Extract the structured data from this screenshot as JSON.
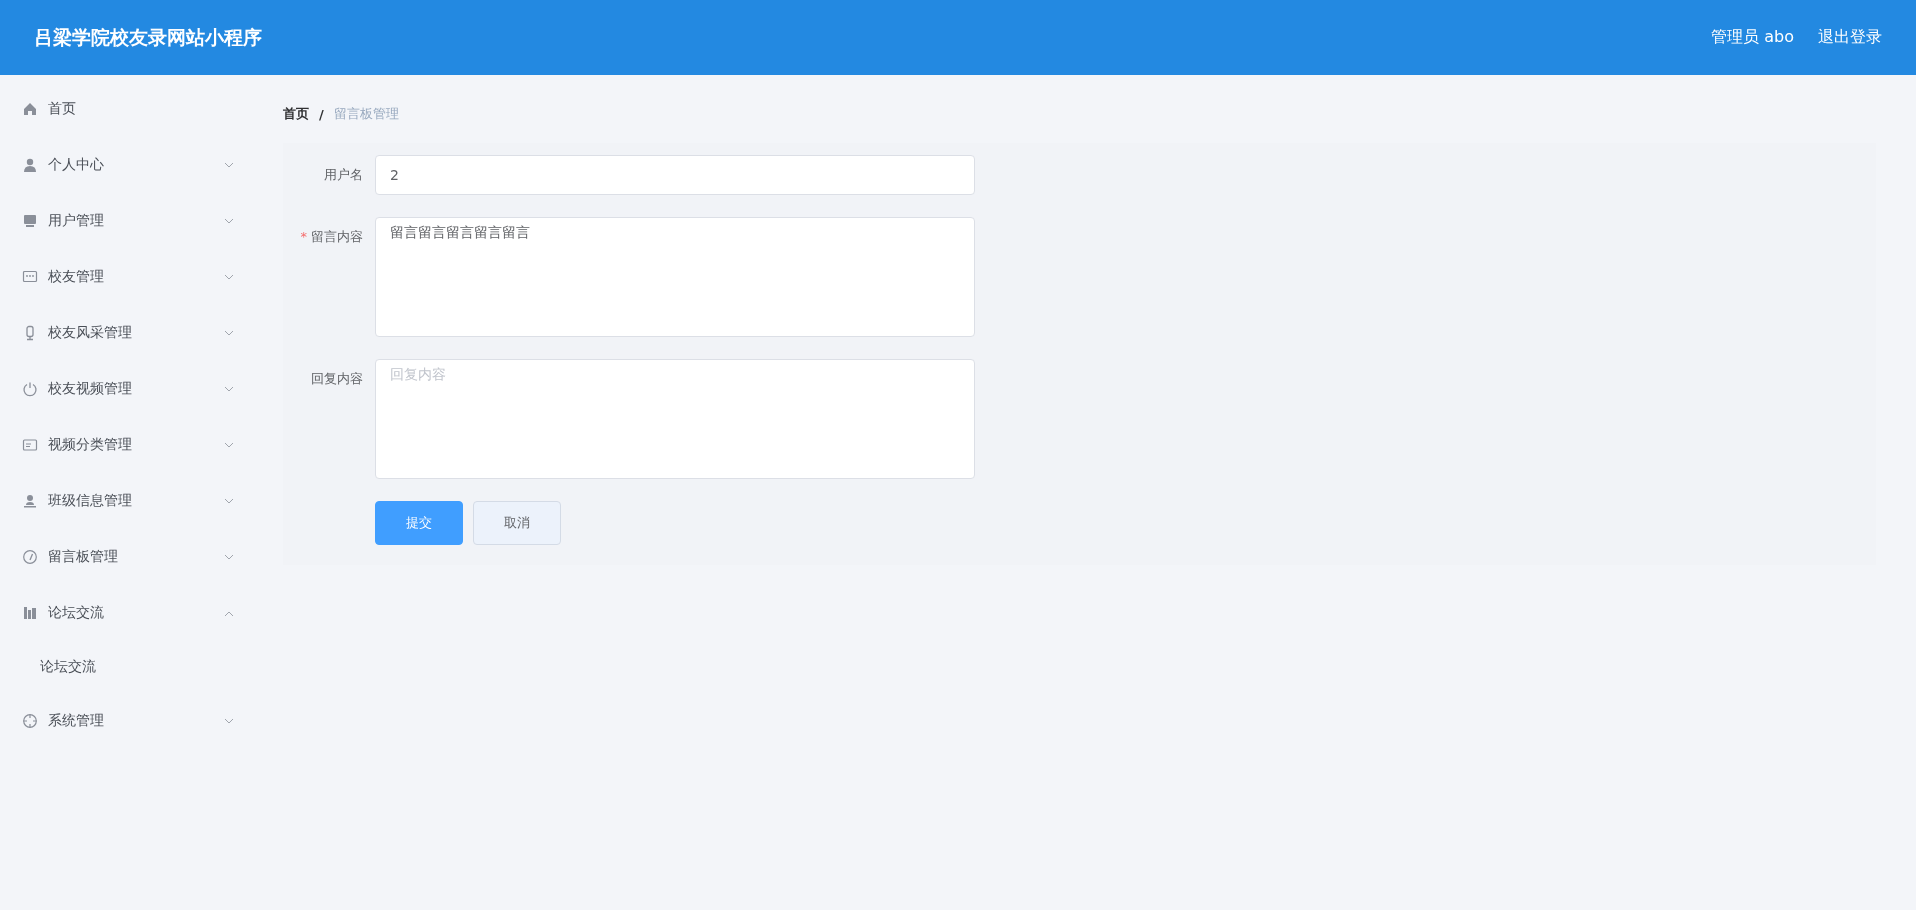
{
  "header": {
    "title": "吕梁学院校友录网站小程序",
    "user": "管理员 abo",
    "logout": "退出登录"
  },
  "sidebar": {
    "items": [
      {
        "kind": "link",
        "label": "首页"
      },
      {
        "kind": "submenu",
        "label": "个人中心",
        "expanded": false
      },
      {
        "kind": "submenu",
        "label": "用户管理",
        "expanded": false
      },
      {
        "kind": "submenu",
        "label": "校友管理",
        "expanded": false
      },
      {
        "kind": "submenu",
        "label": "校友风采管理",
        "expanded": false
      },
      {
        "kind": "submenu",
        "label": "校友视频管理",
        "expanded": false
      },
      {
        "kind": "submenu",
        "label": "视频分类管理",
        "expanded": false
      },
      {
        "kind": "submenu",
        "label": "班级信息管理",
        "expanded": false
      },
      {
        "kind": "submenu",
        "label": "留言板管理",
        "expanded": false
      },
      {
        "kind": "submenu",
        "label": "论坛交流",
        "expanded": true,
        "children": [
          {
            "label": "论坛交流"
          }
        ]
      },
      {
        "kind": "submenu",
        "label": "系统管理",
        "expanded": false
      }
    ]
  },
  "breadcrumb": {
    "separator": "/",
    "items": [
      {
        "label": "首页"
      },
      {
        "label": "留言板管理"
      }
    ]
  },
  "form": {
    "required_mark": "*",
    "fields": [
      {
        "kind": "input",
        "label": "用户名",
        "required": false,
        "value": "2"
      },
      {
        "kind": "textarea",
        "label": "留言内容",
        "required": true,
        "value": "留言留言留言留言留言"
      },
      {
        "kind": "textarea",
        "label": "回复内容",
        "required": false,
        "placeholder": "回复内容"
      }
    ],
    "buttons": [
      {
        "kind": "primary",
        "label": "提交"
      },
      {
        "kind": "default",
        "label": "取消"
      }
    ]
  }
}
